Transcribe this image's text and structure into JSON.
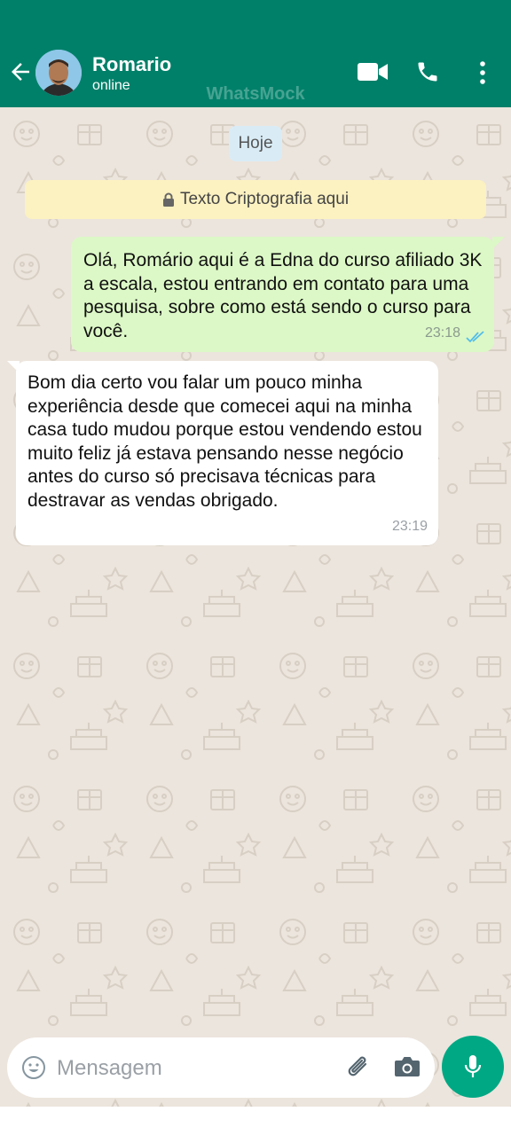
{
  "header": {
    "contact_name": "Romario",
    "status": "online",
    "watermark": "WhatsMock"
  },
  "chat": {
    "date_chip": "Hoje",
    "encryption_notice": "Texto Criptografia aqui",
    "messages": [
      {
        "direction": "outgoing",
        "text": "Olá, Romário aqui é a Edna do curso afiliado 3K a escala, estou entrando em contato para uma pesquisa, sobre como está sendo o curso para você.",
        "time": "23:18",
        "read": true
      },
      {
        "direction": "incoming",
        "text": "Bom dia certo vou falar um pouco minha experiência desde que comecei aqui na minha casa tudo mudou porque estou vendendo estou muito feliz já estava pensando nesse negócio antes do curso só precisava técnicas para destravar as vendas obrigado.",
        "time": "23:19"
      }
    ]
  },
  "composer": {
    "placeholder": "Mensagem"
  },
  "colors": {
    "header": "#008069",
    "outgoing_bubble": "#dcf8c6",
    "incoming_bubble": "#ffffff",
    "read_ticks": "#53bdeb",
    "mic_button": "#00a884"
  },
  "icons": [
    "back-arrow-icon",
    "video-call-icon",
    "phone-icon",
    "more-vert-icon",
    "lock-icon",
    "double-check-icon",
    "emoji-icon",
    "attach-icon",
    "camera-icon",
    "mic-icon"
  ]
}
